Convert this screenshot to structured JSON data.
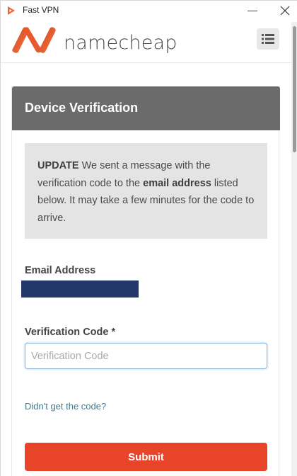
{
  "window": {
    "title": "Fast VPN",
    "minimize_glyph": "—",
    "close_icon": "close-icon"
  },
  "header": {
    "logo_text": "namecheap",
    "brand_color": "#f2623a",
    "menu_icon": "list-menu-icon"
  },
  "card": {
    "title": "Device Verification",
    "notice": {
      "lead": "UPDATE",
      "text_before": " We sent a message with the verification code to the ",
      "emphasis": "email address",
      "text_after": " listed below. It may take a few minutes for the code to arrive."
    },
    "email_label": "Email Address",
    "email_value_redacted": true,
    "code_label": "Verification Code *",
    "code_placeholder": "Verification Code",
    "help_link": "Didn't get the code?",
    "submit_label": "Submit"
  },
  "colors": {
    "header_bg": "#6b6b6b",
    "submit_bg": "#e8442a",
    "link": "#3b7d8e",
    "redaction": "#23366b"
  }
}
